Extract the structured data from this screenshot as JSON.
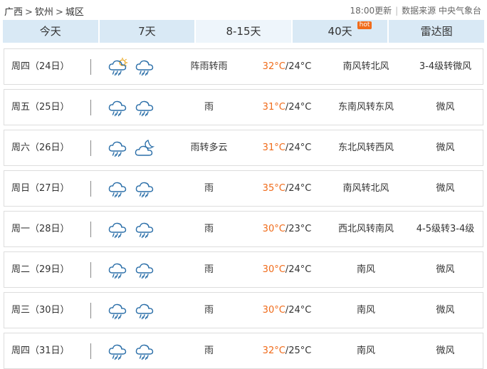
{
  "breadcrumb": [
    "广西",
    "钦州",
    "城区"
  ],
  "breadcrumb_sep": ">",
  "update_time": "18:00更新",
  "source_label": "数据来源 中央气象台",
  "tabs": [
    {
      "label": "今天"
    },
    {
      "label": "7天"
    },
    {
      "label": "8-15天",
      "active": true
    },
    {
      "label": "40天",
      "badge": "hot"
    },
    {
      "label": "雷达图"
    }
  ],
  "colors": {
    "high_temp": "#f06b1a",
    "tab_bg": "#d9e9f5",
    "tab_active_bg": "#eef5fb",
    "icon_stroke": "#2a6ea8"
  },
  "days": [
    {
      "day": "周四（24日）",
      "icons": [
        "thundershower-day-icon",
        "rain-icon"
      ],
      "desc": "阵雨转雨",
      "high": "32°C",
      "low": "24°C",
      "wind_dir": "南风转北风",
      "wind_level": "3-4级转微风"
    },
    {
      "day": "周五（25日）",
      "icons": [
        "rain-icon",
        "rain-icon"
      ],
      "desc": "雨",
      "high": "31°C",
      "low": "24°C",
      "wind_dir": "东南风转东风",
      "wind_level": "微风"
    },
    {
      "day": "周六（26日）",
      "icons": [
        "rain-icon",
        "partly-cloudy-night-icon"
      ],
      "desc": "雨转多云",
      "high": "31°C",
      "low": "24°C",
      "wind_dir": "东北风转西风",
      "wind_level": "微风"
    },
    {
      "day": "周日（27日）",
      "icons": [
        "rain-icon",
        "rain-icon"
      ],
      "desc": "雨",
      "high": "35°C",
      "low": "24°C",
      "wind_dir": "南风转北风",
      "wind_level": "微风"
    },
    {
      "day": "周一（28日）",
      "icons": [
        "rain-icon",
        "rain-icon"
      ],
      "desc": "雨",
      "high": "30°C",
      "low": "23°C",
      "wind_dir": "西北风转南风",
      "wind_level": "4-5级转3-4级"
    },
    {
      "day": "周二（29日）",
      "icons": [
        "rain-icon",
        "rain-icon"
      ],
      "desc": "雨",
      "high": "30°C",
      "low": "24°C",
      "wind_dir": "南风",
      "wind_level": "微风"
    },
    {
      "day": "周三（30日）",
      "icons": [
        "rain-icon",
        "rain-icon"
      ],
      "desc": "雨",
      "high": "30°C",
      "low": "24°C",
      "wind_dir": "南风",
      "wind_level": "微风"
    },
    {
      "day": "周四（31日）",
      "icons": [
        "rain-icon",
        "rain-icon"
      ],
      "desc": "雨",
      "high": "32°C",
      "low": "25°C",
      "wind_dir": "南风",
      "wind_level": "微风"
    }
  ]
}
